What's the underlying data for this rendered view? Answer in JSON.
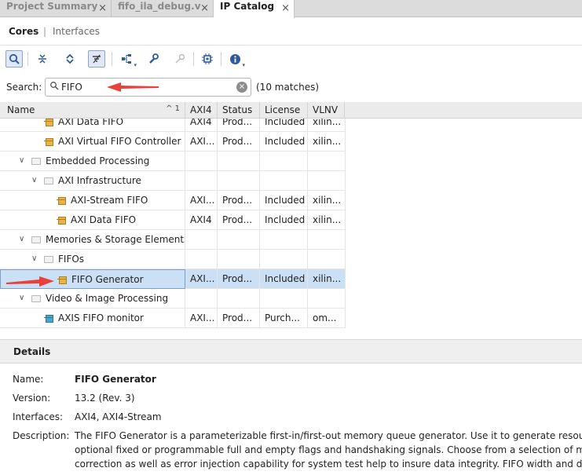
{
  "tabs": [
    {
      "label": "Project Summary",
      "active": false
    },
    {
      "label": "fifo_ila_debug.v",
      "active": false
    },
    {
      "label": "IP Catalog",
      "active": true
    }
  ],
  "close_glyph": "×",
  "subtabs": {
    "cores": "Cores",
    "separator": "|",
    "interfaces": "Interfaces"
  },
  "toolbar_icons": [
    "search-icon",
    "collapse-all-icon",
    "expand-all-icon",
    "filter-icon",
    "hierarchy-icon",
    "wrench-icon",
    "key-icon",
    "chip-icon",
    "info-icon"
  ],
  "search": {
    "label": "Search:",
    "value": "FIFO",
    "matches": "(10 matches)"
  },
  "columns": {
    "name": "Name",
    "sort_indicator": "^ 1",
    "axi4": "AXI4",
    "status": "Status",
    "license": "License",
    "vlnv": "VLNV"
  },
  "rows": [
    {
      "type": "ip",
      "level": 2,
      "name": "AXI Data FIFO",
      "axi4": "AXI4",
      "status": "Prod...",
      "license": "Included",
      "vlnv": "xilin..."
    },
    {
      "type": "ip",
      "level": 2,
      "name": "AXI Virtual FIFO Controller",
      "axi4": "AXI...",
      "status": "Prod...",
      "license": "Included",
      "vlnv": "xilin..."
    },
    {
      "type": "folder",
      "level": 1,
      "name": "Embedded Processing"
    },
    {
      "type": "folder",
      "level": 2,
      "name": "AXI Infrastructure"
    },
    {
      "type": "ip",
      "level": 3,
      "name": "AXI-Stream FIFO",
      "axi4": "AXI...",
      "status": "Prod...",
      "license": "Included",
      "vlnv": "xilin..."
    },
    {
      "type": "ip",
      "level": 3,
      "name": "AXI Data FIFO",
      "axi4": "AXI4",
      "status": "Prod...",
      "license": "Included",
      "vlnv": "xilin..."
    },
    {
      "type": "folder",
      "level": 1,
      "name": "Memories & Storage Elements"
    },
    {
      "type": "folder",
      "level": 2,
      "name": "FIFOs"
    },
    {
      "type": "ip",
      "level": 3,
      "name": "FIFO Generator",
      "axi4": "AXI...",
      "status": "Prod...",
      "license": "Included",
      "vlnv": "xilin...",
      "selected": true
    },
    {
      "type": "folder",
      "level": 1,
      "name": "Video & Image Processing"
    },
    {
      "type": "ip",
      "level": 2,
      "name": "AXIS FIFO monitor",
      "axi4": "AXI...",
      "status": "Prod...",
      "license": "Purch...",
      "vlnv": "om...",
      "icon": "teal"
    }
  ],
  "details": {
    "title": "Details",
    "name_label": "Name:",
    "name": "FIFO Generator",
    "version_label": "Version:",
    "version": "13.2 (Rev. 3)",
    "interfaces_label": "Interfaces:",
    "interfaces": "AXI4, AXI4-Stream",
    "description_label": "Description:",
    "description_lines": [
      "The FIFO Generator is a parameterizable first-in/first-out memory queue generator. Use it to generate resource and per",
      "optional fixed or programmable full and empty flags and handshaking signals.  Choose from a selection of memory res",
      "correction as well as error injection capability for system test help to insure data integrity.  FIFO width and depth are para"
    ]
  },
  "accent_colors": {
    "selection": "#cce0f5",
    "annotation_arrow": "#e8413c"
  }
}
